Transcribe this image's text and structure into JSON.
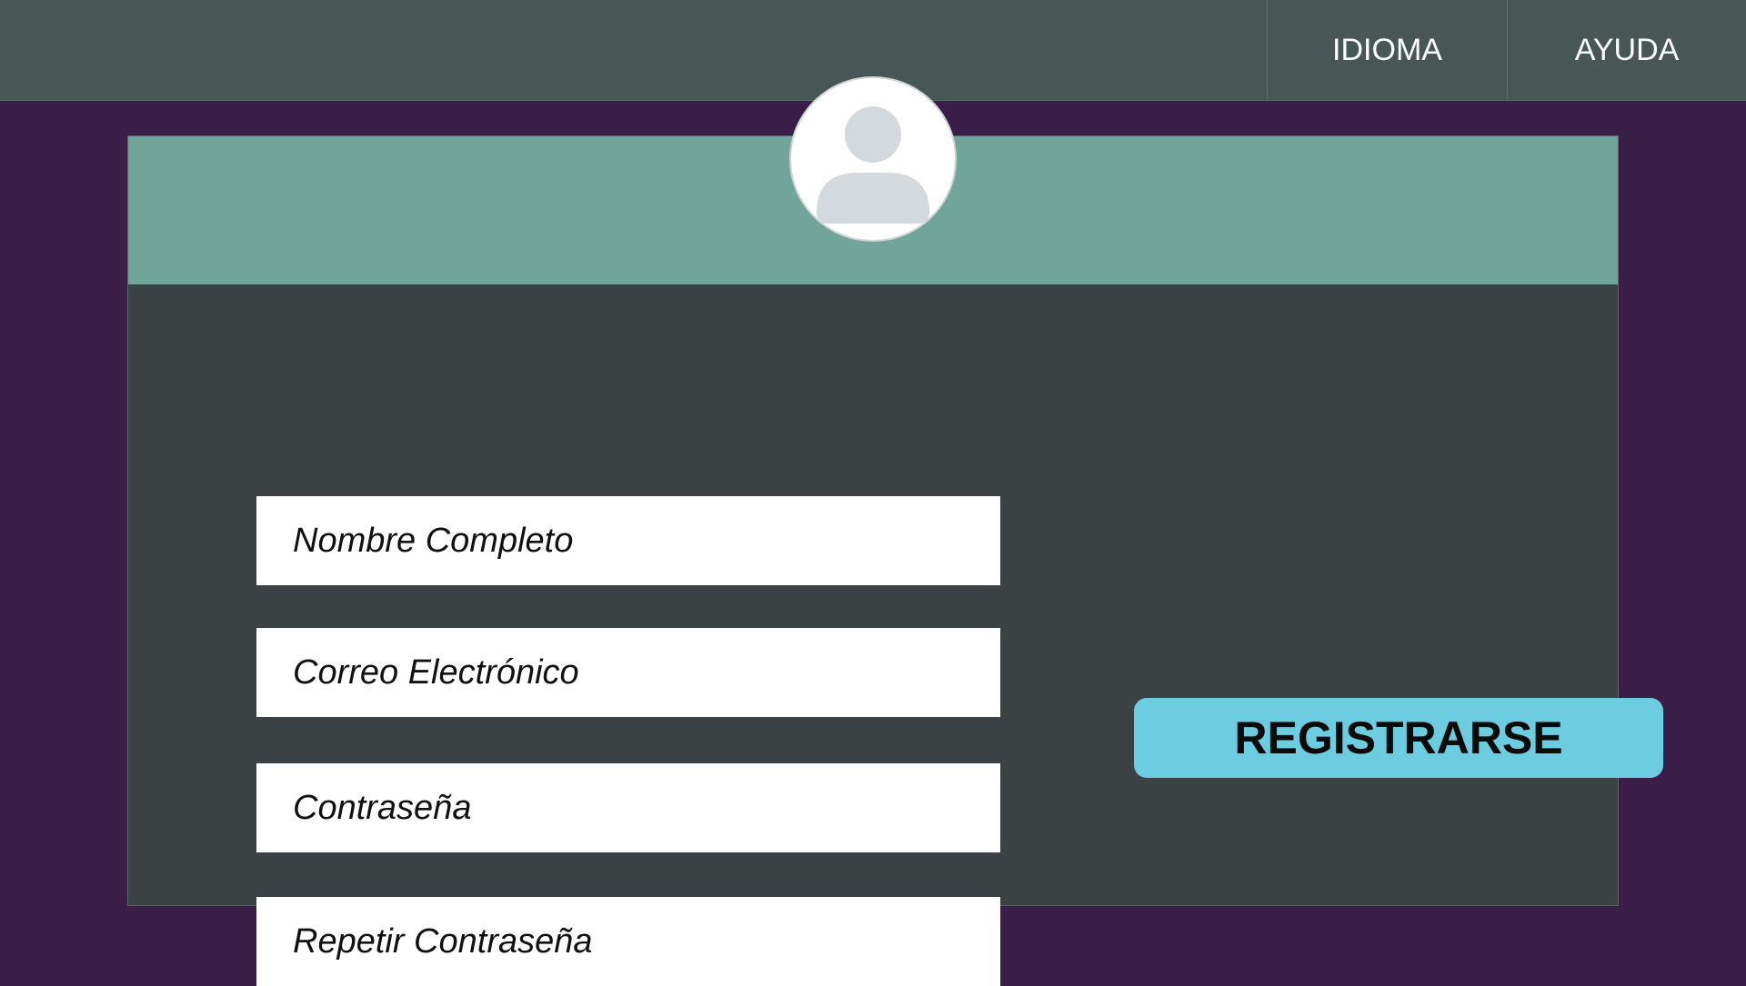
{
  "nav": {
    "items": [
      {
        "label": "IDIOMA"
      },
      {
        "label": "AYUDA"
      }
    ]
  },
  "avatar": {
    "icon": "user-placeholder-icon"
  },
  "form": {
    "fields": [
      {
        "placeholder": "Nombre Completo"
      },
      {
        "placeholder": "Correo Electrónico"
      },
      {
        "placeholder": "Contraseña"
      },
      {
        "placeholder": "Repetir Contraseña"
      }
    ],
    "submit_label": "REGISTRARSE"
  },
  "colors": {
    "background": "#3a1e47",
    "topbar": "#475755",
    "card_header": "#72a59a",
    "card_body": "#3c4243",
    "button": "#6ccde1"
  }
}
